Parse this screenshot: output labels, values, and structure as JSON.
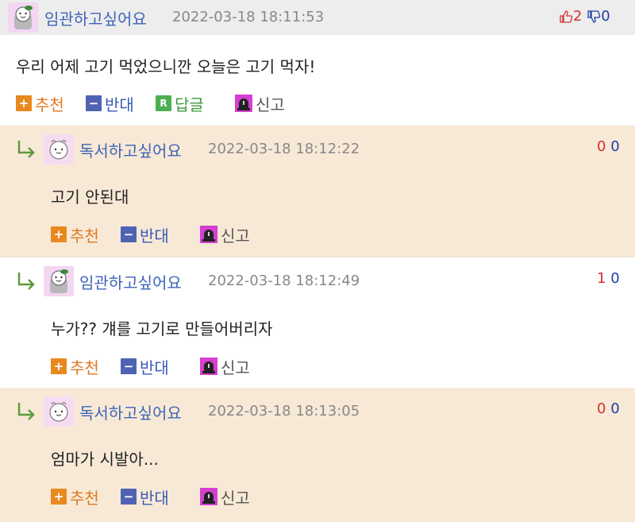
{
  "main": {
    "nickname": "임관하고싶어요",
    "timestamp": "2022-03-18 18:11:53",
    "content": "우리 어제 고기 먹었으니깐 오늘은 고기 먹자!",
    "upvotes": "2",
    "downvotes": "0",
    "actions": {
      "recommend": "추천",
      "oppose": "반대",
      "reply": "답글",
      "report": "신고"
    }
  },
  "replies": [
    {
      "nickname": "독서하고싶어요",
      "timestamp": "2022-03-18 18:12:22",
      "content": "고기 안된대",
      "upvotes": "0",
      "downvotes": "0",
      "actions": {
        "recommend": "추천",
        "oppose": "반대",
        "report": "신고"
      }
    },
    {
      "nickname": "임관하고싶어요",
      "timestamp": "2022-03-18 18:12:49",
      "content": "누가?? 걔를 고기로 만들어버리자",
      "upvotes": "1",
      "downvotes": "0",
      "actions": {
        "recommend": "추천",
        "oppose": "반대",
        "report": "신고"
      }
    },
    {
      "nickname": "독서하고싶어요",
      "timestamp": "2022-03-18 18:13:05",
      "content": "엄마가 시발아...",
      "upvotes": "0",
      "downvotes": "0",
      "actions": {
        "recommend": "추천",
        "oppose": "반대",
        "report": "신고"
      }
    }
  ],
  "icons": {
    "plus": "+",
    "minus": "−",
    "reply_badge": "R"
  },
  "colors": {
    "nickname": "#3e66b8",
    "reply_background": "#f8e9d6",
    "header_background": "#ededed",
    "upvote": "#d42f2f",
    "downvote": "#1d3fa8",
    "recommend": "#e8891f",
    "oppose": "#5063b2",
    "reply": "#4caf50"
  }
}
